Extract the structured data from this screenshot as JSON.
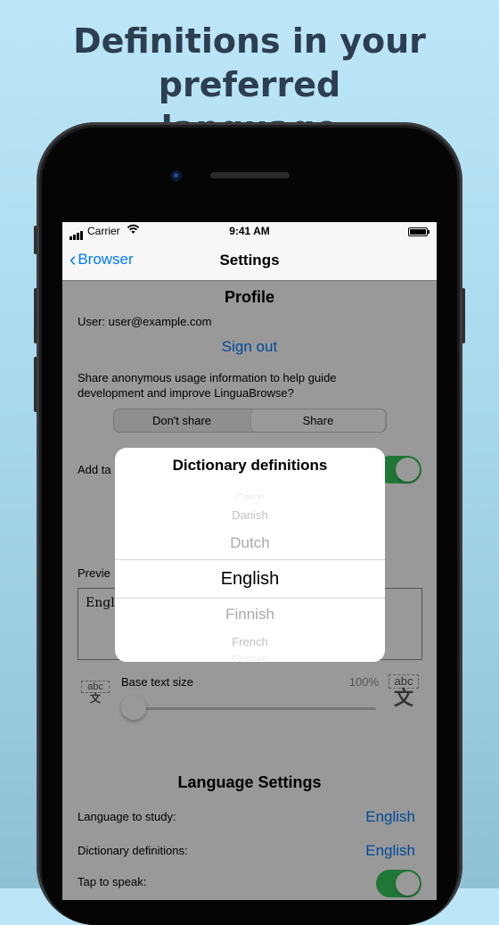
{
  "headline": {
    "line1": "Definitions in your preferred",
    "line2": "language"
  },
  "status_bar": {
    "carrier": "Carrier",
    "time": "9:41 AM"
  },
  "nav": {
    "back_label": "Browser",
    "title": "Settings"
  },
  "profile": {
    "section_title": "Profile",
    "user_text": "User: user@example.com",
    "sign_out": "Sign out",
    "share_prompt_line1": "Share anonymous usage information to help guide",
    "share_prompt_line2": "development and improve LinguaBrowse?",
    "segment_dont_share": "Don't share",
    "segment_share": "Share",
    "add_tabs_label": "Add ta",
    "preview_label": "Previe",
    "preview_text": "Engli",
    "base_text_size_label": "Base text size",
    "base_text_size_value": "100%",
    "text_size_level": 0.0,
    "abc_small": "abc",
    "kanji_small": "文",
    "abc_large": "abc",
    "kanji_large": "文"
  },
  "picker": {
    "title": "Dictionary definitions",
    "options_above": [
      "Czech",
      "Danish",
      "Dutch"
    ],
    "selected": "English",
    "options_below": [
      "Finnish",
      "French",
      "German"
    ]
  },
  "language_settings": {
    "section_title": "Language Settings",
    "rows": [
      {
        "label": "Language to study:",
        "value": "English"
      },
      {
        "label": "Dictionary definitions:",
        "value": "English"
      },
      {
        "label": "Tap to speak:"
      }
    ]
  },
  "colors": {
    "accent": "#007aff",
    "toggle_on": "#34c759",
    "headline": "#2c3e50"
  }
}
